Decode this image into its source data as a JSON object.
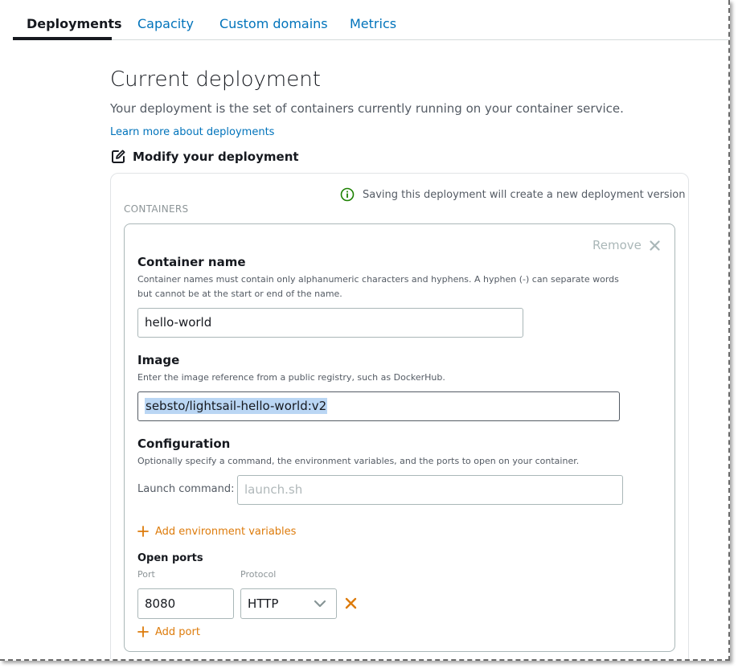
{
  "tabs": [
    {
      "label": "Deployments"
    },
    {
      "label": "Capacity"
    },
    {
      "label": "Custom domains"
    },
    {
      "label": "Metrics"
    }
  ],
  "page": {
    "title": "Current deployment",
    "description": "Your deployment is the set of containers currently running on your container service.",
    "learn_more": "Learn more about deployments",
    "modify_label": "Modify your deployment"
  },
  "panel": {
    "info_text": "Saving this deployment will create a new deployment version",
    "containers_heading": "CONTAINERS"
  },
  "container": {
    "remove_label": "Remove",
    "name": {
      "label": "Container name",
      "help_line1": "Container names must contain only alphanumeric characters and hyphens. A hyphen (-) can separate words",
      "help_line2": "but cannot be at the start or end of the name.",
      "value": "hello-world"
    },
    "image": {
      "label": "Image",
      "help": "Enter the image reference from a public registry, such as DockerHub.",
      "value": "sebsto/lightsail-hello-world:v2"
    },
    "configuration": {
      "label": "Configuration",
      "help": "Optionally specify a command, the environment variables, and the ports to open on your container.",
      "launch_label": "Launch command:",
      "launch_placeholder": "launch.sh",
      "add_env_label": "Add environment variables"
    },
    "ports": {
      "label": "Open ports",
      "port_label": "Port",
      "protocol_label": "Protocol",
      "port_value": "8080",
      "protocol_value": "HTTP",
      "add_port_label": "Add port"
    }
  },
  "colors": {
    "link": "#0073bb",
    "accent_orange": "#dd7b0b",
    "success_green": "#1d8102",
    "text": "#16191f",
    "muted": "#545b64"
  }
}
